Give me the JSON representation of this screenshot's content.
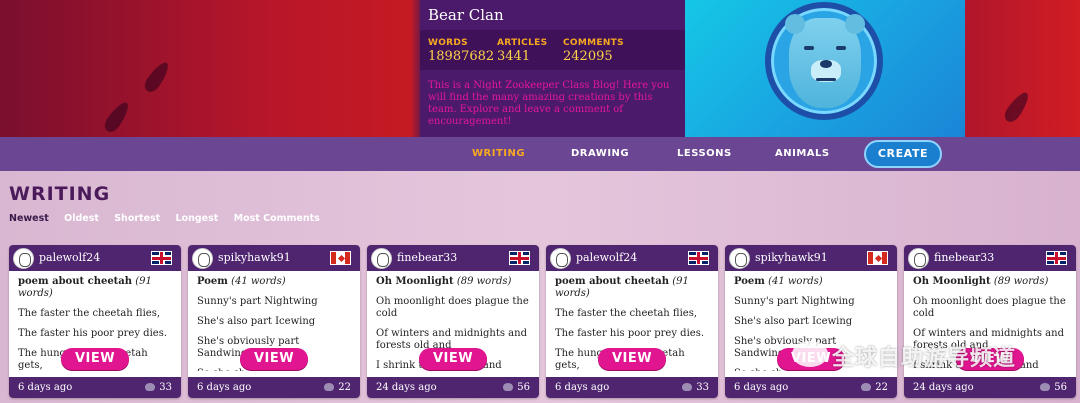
{
  "header": {
    "clan_name": "Bear Clan",
    "stats": [
      {
        "label": "WORDS",
        "value": "18987682"
      },
      {
        "label": "ARTICLES",
        "value": "3441"
      },
      {
        "label": "COMMENTS",
        "value": "242095"
      }
    ],
    "description": "This is a Night Zookeeper Class Blog! Here you will find the many amazing creations by this team. Explore and leave a comment of encouragement!"
  },
  "nav": {
    "links": [
      "WRITING",
      "DRAWING",
      "LESSONS",
      "ANIMALS"
    ],
    "active": "WRITING",
    "create_label": "CREATE"
  },
  "page": {
    "title": "WRITING",
    "sorts": [
      "Newest",
      "Oldest",
      "Shortest",
      "Longest",
      "Most Comments"
    ],
    "active_sort": "Newest"
  },
  "cards": [
    {
      "user": "palewolf24",
      "flag": "uk",
      "title": "poem about cheetah",
      "words": "(91 words)",
      "lines": [
        "The faster the cheetah flies,",
        "The faster his poor prey dies.",
        "The hungrier the cheetah gets,",
        "The longe"
      ],
      "view_label": "VIEW",
      "ago": "6 days ago",
      "likes": "33"
    },
    {
      "user": "spikyhawk91",
      "flag": "ca",
      "title": "Poem",
      "words": "(41 words)",
      "lines": [
        "Sunny's part Nightwing",
        "She's also part Icewing",
        "She's obviously part Sandwing",
        "So she sh                owered"
      ],
      "view_label": "VIEW",
      "ago": "6 days ago",
      "likes": "22"
    },
    {
      "user": "finebear33",
      "flag": "uk",
      "title": "Oh Moonlight",
      "words": "(89 words)",
      "lines": [
        "Oh moonlight does plague the cold",
        "Of winters and midnights and forests old and",
        "I shrink th               s of night and"
      ],
      "view_label": "VIEW",
      "ago": "24 days ago",
      "likes": "56"
    },
    {
      "user": "palewolf24",
      "flag": "uk",
      "title": "poem about cheetah",
      "words": "(91 words)",
      "lines": [
        "The faster the cheetah flies,",
        "The faster his poor prey dies.",
        "The hungrier the cheetah gets,",
        "The longe"
      ],
      "view_label": "VIEW",
      "ago": "6 days ago",
      "likes": "33"
    },
    {
      "user": "spikyhawk91",
      "flag": "ca",
      "title": "Poem",
      "words": "(41 words)",
      "lines": [
        "Sunny's part Nightwing",
        "She's also part Icewing",
        "She's obviously part Sandwing",
        "So she sh"
      ],
      "view_label": "VIEW",
      "ago": "6 days ago",
      "likes": "22"
    },
    {
      "user": "finebear33",
      "flag": "uk",
      "title": "Oh Moonlight",
      "words": "(89 words)",
      "lines": [
        "Oh moonlight does plague the cold",
        "Of winters and midnights and forests old and",
        "I shrink th               s of night and"
      ],
      "view_label": "VIEW",
      "ago": "24 days ago",
      "likes": "56"
    }
  ],
  "watermark": "全球自助游导频道",
  "colors": {
    "accent_pink": "#e0158f",
    "nav_purple": "#6b4693",
    "card_header": "#4f2570",
    "stat_gold": "#f6a821"
  }
}
